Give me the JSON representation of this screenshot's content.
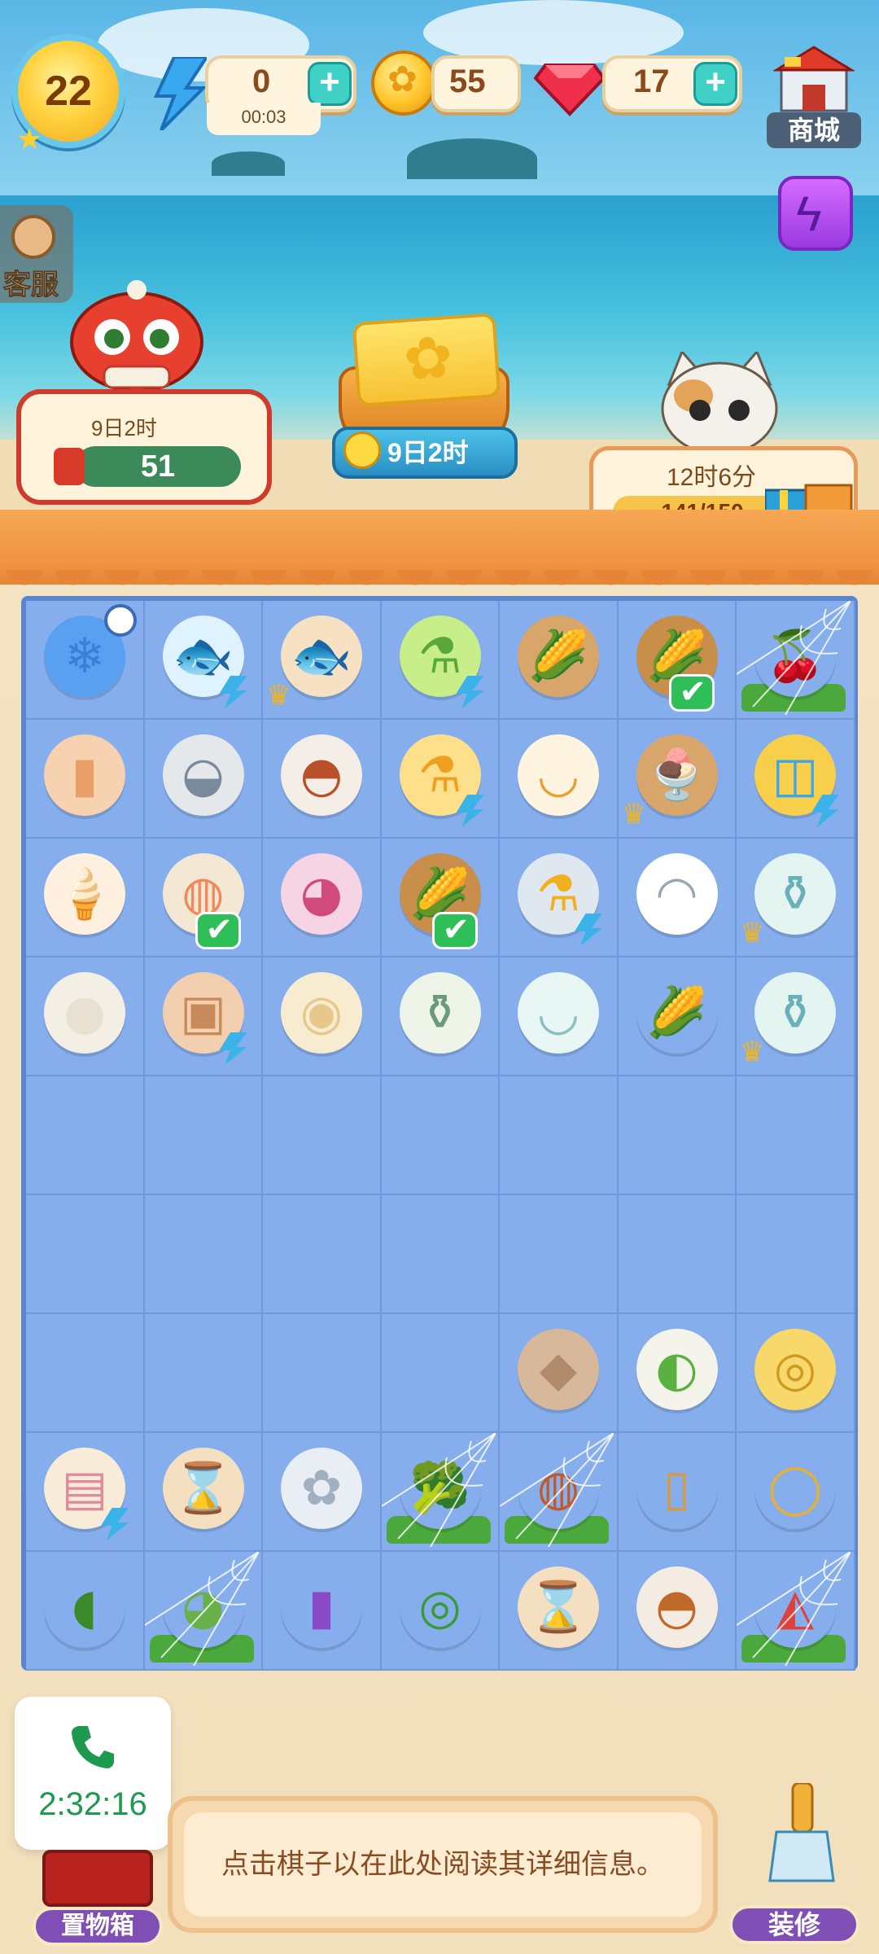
{
  "top_bar": {
    "level": "22",
    "energy": {
      "value": "0",
      "timer": "00:03"
    },
    "coins": {
      "value": "55"
    },
    "gems": {
      "value": "17"
    },
    "shop_label": "商城",
    "customer_service_label": "客服",
    "plus": "+"
  },
  "events": {
    "lion": {
      "timer": "9日2时",
      "count": "51"
    },
    "ticket": {
      "timer": "9日2时"
    },
    "cat": {
      "timer": "12时6分",
      "progress": "141/150",
      "progress_value": 141,
      "progress_max": 150
    }
  },
  "board": {
    "rows": [
      [
        "fridge-timer",
        "goldfish-bag",
        "fish-platter",
        "green-juicer",
        "corn-basket",
        "corn-steamer-check",
        "cherries-web"
      ],
      [
        "popsicle",
        "oysters",
        "stew-dish",
        "orange-juicer",
        "soup-bowl",
        "ice-cream-cup",
        "water-bucket"
      ],
      [
        "ice-cream-cone",
        "fried-rice-check",
        "noodle-bowl",
        "corn-steamer-check",
        "blender",
        "tea-bowl",
        "tea-set"
      ],
      [
        "garlic",
        "paper-bag",
        "bun",
        "vase",
        "teacup",
        "corn-cob",
        "tea-set"
      ],
      [
        "",
        "",
        "",
        "",
        "",
        "",
        ""
      ],
      [
        "",
        "",
        "",
        "",
        "",
        "",
        ""
      ],
      [
        "",
        "",
        "",
        "",
        "cloth-bundle",
        "juice-squeezer",
        "coin-dispenser"
      ],
      [
        "sandwich",
        "hourglass",
        "flower-bowl",
        "broccoli-web",
        "pizza-web",
        "spatula",
        "strainer"
      ],
      [
        "cucumber",
        "cabbage-web",
        "bottle",
        "peas",
        "hourglass",
        "roast-chicken",
        "watermelon-web"
      ]
    ]
  },
  "bottom": {
    "call_time": "2:32:16",
    "chest_label": "置物箱",
    "info_text": "点击棋子以在此处阅读其详细信息。",
    "decorate_label": "装修"
  },
  "colors": {
    "board_bg": "#86aeec",
    "awning": "#f19342",
    "accent_purple": "#7f4fb5",
    "call_green": "#1e9a50"
  }
}
